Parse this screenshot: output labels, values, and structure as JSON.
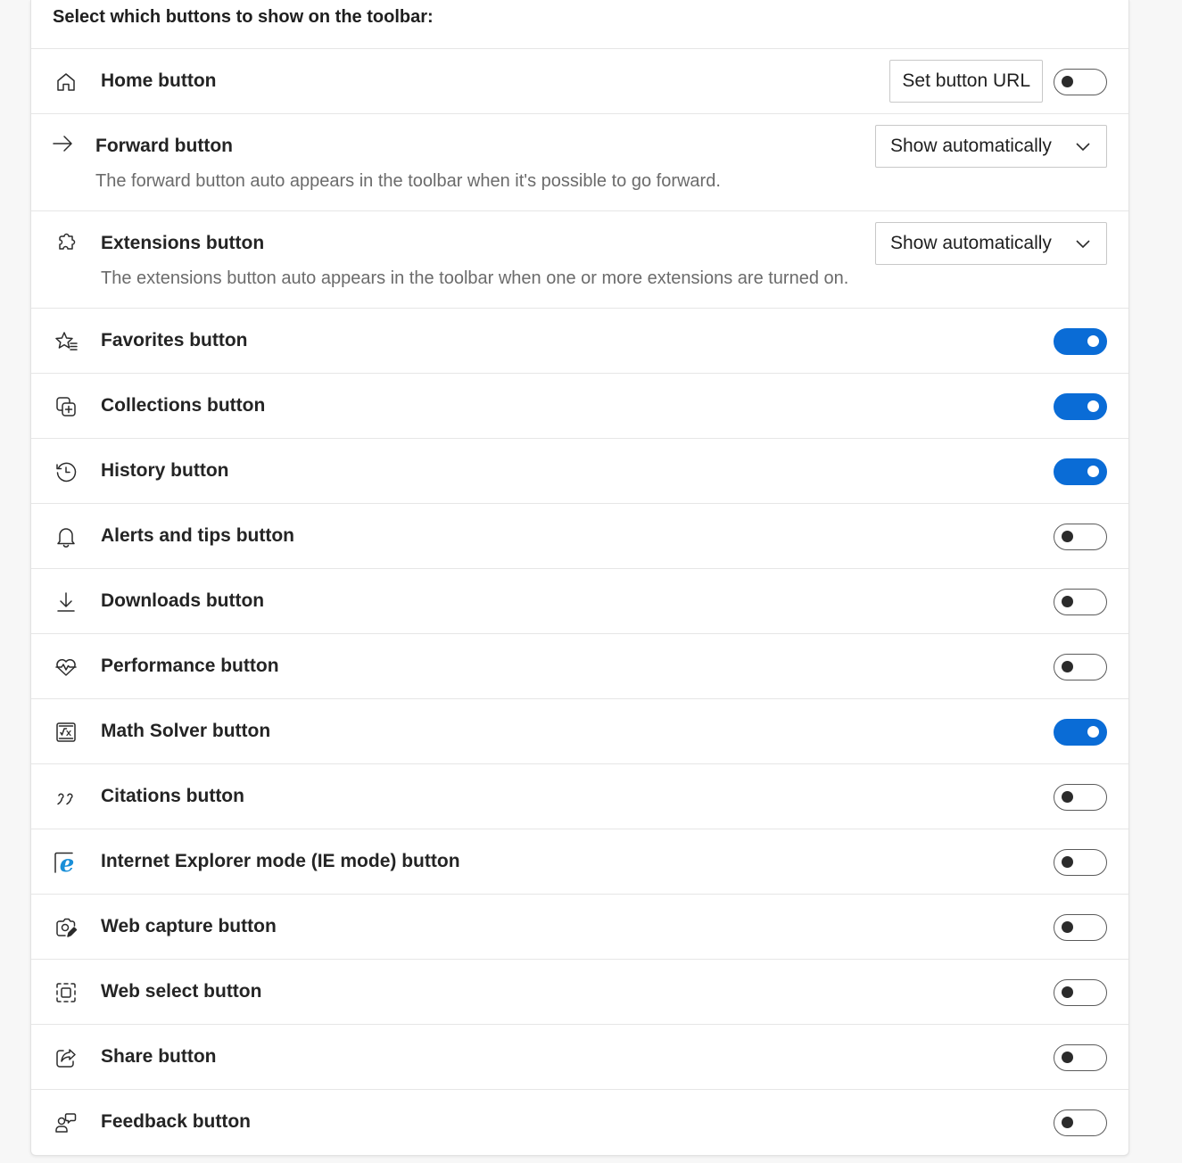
{
  "header": {
    "title": "Select which buttons to show on the toolbar:"
  },
  "colors": {
    "accent": "#0a6cd6",
    "ie_blue": "#1a8fd8"
  },
  "home": {
    "label": "Home button",
    "icon": "home-icon",
    "set_url_label": "Set button URL",
    "enabled": false
  },
  "forward": {
    "label": "Forward button",
    "icon": "arrow-right-icon",
    "select_value": "Show automatically",
    "description": "The forward button auto appears in the toolbar when it's possible to go forward."
  },
  "extensions": {
    "label": "Extensions button",
    "icon": "puzzle-icon",
    "select_value": "Show automatically",
    "description": "The extensions button auto appears in the toolbar when one or more extensions are turned on."
  },
  "toggles": [
    {
      "label": "Favorites button",
      "icon": "favorites-star-icon",
      "enabled": true
    },
    {
      "label": "Collections button",
      "icon": "collections-icon",
      "enabled": true
    },
    {
      "label": "History button",
      "icon": "history-icon",
      "enabled": true
    },
    {
      "label": "Alerts and tips button",
      "icon": "bell-icon",
      "enabled": false
    },
    {
      "label": "Downloads button",
      "icon": "download-icon",
      "enabled": false
    },
    {
      "label": "Performance button",
      "icon": "heart-pulse-icon",
      "enabled": false
    },
    {
      "label": "Math Solver button",
      "icon": "math-solver-icon",
      "enabled": true
    },
    {
      "label": " Citations button",
      "icon": "quote-icon",
      "enabled": false
    },
    {
      "label": "Internet Explorer mode (IE mode) button",
      "icon": "ie-mode-icon",
      "icon_glyph": "e",
      "enabled": false
    },
    {
      "label": "Web capture button",
      "icon": "web-capture-icon",
      "enabled": false
    },
    {
      "label": "Web select button",
      "icon": "web-select-icon",
      "enabled": false
    },
    {
      "label": "Share button",
      "icon": "share-icon",
      "enabled": false
    },
    {
      "label": "Feedback button",
      "icon": "feedback-icon",
      "enabled": false
    }
  ]
}
